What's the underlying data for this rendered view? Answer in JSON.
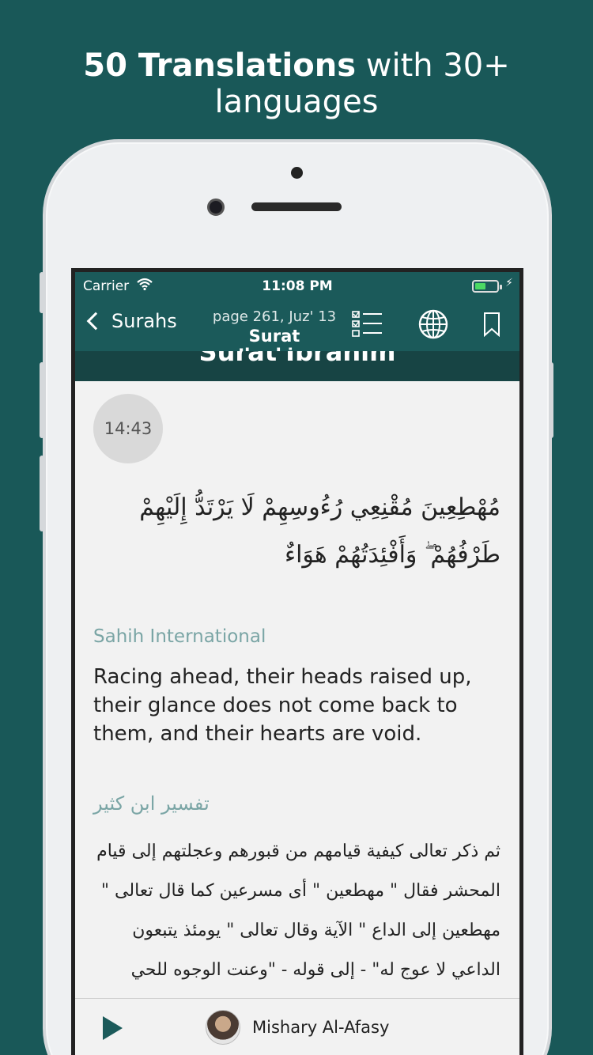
{
  "headline": {
    "bold": "50 Translations",
    "rest": " with 30+ languages"
  },
  "status_bar": {
    "carrier": "Carrier",
    "time": "11:08 PM",
    "battery_level": 0.5
  },
  "nav": {
    "back_label": "Surahs",
    "subtitle": "page 261, Juz' 13",
    "title": "Surat Ibrahim"
  },
  "header_strip_title": "Surat Ibrahim",
  "verse": {
    "time": "14:43",
    "arabic": "مُهْطِعِينَ مُقْنِعِي رُءُوسِهِمْ لَا يَرْتَدُّ إِلَيْهِمْ طَرْفُهُمْ ۖ وَأَفْئِدَتُهُمْ هَوَاءٌ",
    "translation_name": "Sahih International",
    "translation_text": "Racing ahead, their heads raised up, their glance does not come back to them, and their hearts are void.",
    "tafsir_name": "تفسير ابن كثير",
    "tafsir_text": "ثم ذكر تعالى كيفية قيامهم من قبورهم وعجلتهم إلى قيام المحشر فقال \" مهطعين \" أى مسرعين كما قال تعالى \" مهطعين إلى الداع \" الآية وقال تعالى \" يومئذ يتبعون الداعي لا عوج له\" - إلى قوله - \"وعنت الوجوه للحي القيوم"
  },
  "player": {
    "reciter": "Mishary Al-Afasy"
  },
  "colors": {
    "background": "#195858",
    "navbar": "#1b5a5a",
    "accent_text": "#7aa5a5"
  },
  "icons": [
    "wifi-icon",
    "battery-icon",
    "chevron-left-icon",
    "checklist-icon",
    "globe-icon",
    "bookmark-icon",
    "play-icon"
  ]
}
